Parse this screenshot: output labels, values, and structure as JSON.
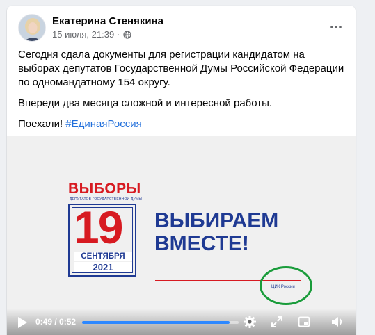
{
  "post": {
    "author": "Екатерина Стенякина",
    "timestamp": "15 июля, 21:39",
    "separator": "·",
    "privacy_icon": "globe-icon",
    "more_icon": "more-horizontal-icon",
    "paragraph1": "Сегодня сдала документы для регистрации кандидатом на выборах депутатов Государственной Думы Российской Федерации по одномандатному 154 округу.",
    "paragraph2": "Впереди два месяца сложной и интересной работы.",
    "paragraph3_text": "Поехали! ",
    "hashtag": "#ЕдинаяРоссия"
  },
  "video": {
    "logo_title": "ВЫБОРЫ",
    "logo_subtitle": "ДЕПУТАТОВ ГОСУДАРСТВЕННОЙ ДУМЫ",
    "logo_day": "19",
    "logo_month": "СЕНТЯБРЯ",
    "logo_year": "2021",
    "slogan_line1": "ВЫБИРАЕМ",
    "slogan_line2": "ВМЕСТЕ!",
    "cik_caption": "ЦИК России",
    "annotation_color": "#1a9c3b",
    "brand_red": "#d71a21",
    "brand_blue": "#1f3a93"
  },
  "player": {
    "current_time": "0:49",
    "duration": "0:52",
    "time_display": "0:49 / 0:52",
    "progress_fraction": 0.94,
    "icons": [
      "play-icon",
      "settings-gear-icon",
      "fullscreen-expand-icon",
      "picture-in-picture-icon",
      "volume-icon"
    ]
  }
}
